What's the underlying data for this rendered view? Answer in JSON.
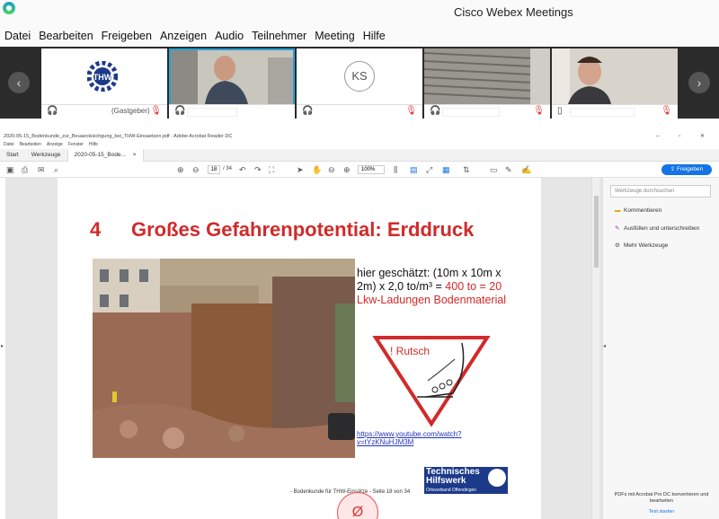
{
  "app": {
    "title": "Cisco Webex Meetings"
  },
  "menu": [
    "Datei",
    "Bearbeiten",
    "Freigeben",
    "Anzeigen",
    "Audio",
    "Teilnehmer",
    "Meeting",
    "Hilfe"
  ],
  "participants": {
    "host_label": "(Gastgeber)",
    "initials": "KS"
  },
  "acrobat": {
    "window_title": "2020-05-15_Bodenkunde_zur_Beuaeckisichgung_bei_THW-Einsaetzen.pdf - Adobe Acrobat Reader DC",
    "menu": [
      "Datei",
      "Bearbeiten",
      "Anzeige",
      "Fenster",
      "Hilfe"
    ],
    "tabs": [
      "Start",
      "Werkzeuge",
      "2020-05-15_Bode..."
    ],
    "page_current": "18",
    "page_total": "/ 34",
    "zoom": "100%",
    "share_label": "Freigeben"
  },
  "slide": {
    "number": "4",
    "title": "Großes Gefahrenpotential: Erddruck",
    "estimate_black": "hier geschätzt: (10m x 10m x 2m) x 2,0 to/m³ = ",
    "estimate_red": "400 to = 20 Lkw-Ladungen Bodenmaterial",
    "warning_label": "! Rutsch",
    "link": "https://www.youtube.com/watch?v=tYzKNuHJM3M",
    "logo_line1": "Technisches",
    "logo_line2": "Hilfswerk",
    "logo_line3": "Ortsverband Offendingen",
    "footer": "- Bodenkunde für THW-Einsätze - Seite 18 von 34",
    "annotation": "Ø"
  },
  "sidepanel": {
    "search_placeholder": "Werkzeuge durchsuchen",
    "items": [
      "Kommentieren",
      "Ausfüllen und unterschreiben",
      "Mehr Werkzeuge"
    ],
    "promo": "PDFs mit Acrobat Pro DC konvertieren und bearbeiten",
    "promo_link": "Test starten"
  }
}
